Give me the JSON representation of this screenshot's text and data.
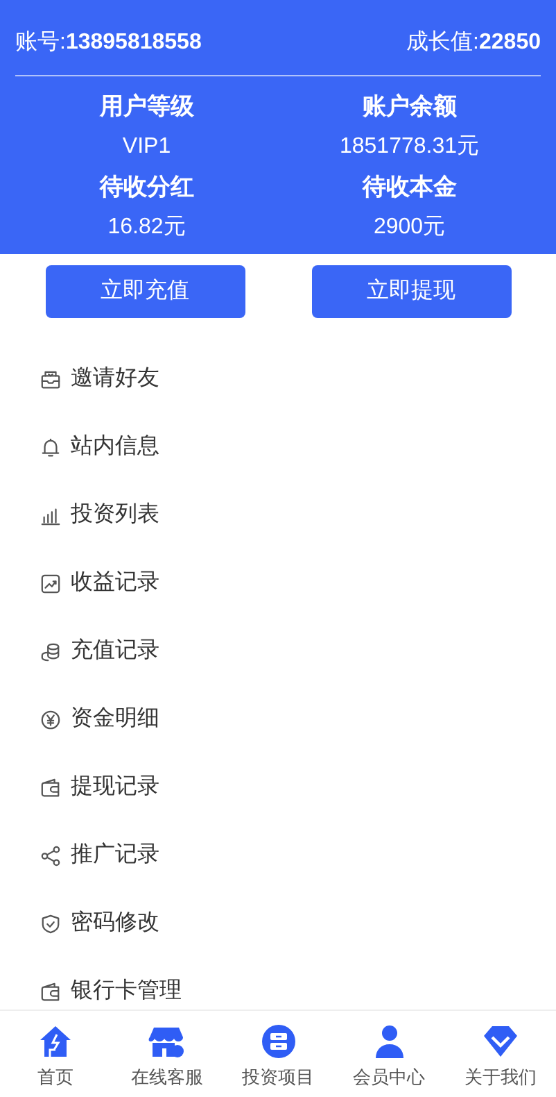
{
  "account": {
    "label": "账号:",
    "value": "13895818558"
  },
  "growth": {
    "label": "成长值:",
    "value": "22850"
  },
  "stats": [
    {
      "label": "用户等级",
      "value": "VIP1"
    },
    {
      "label": "账户余额",
      "value": "1851778.31元"
    },
    {
      "label": "待收分红",
      "value": "16.82元"
    },
    {
      "label": "待收本金",
      "value": "2900元"
    }
  ],
  "actions": [
    "立即充值",
    "立即提现"
  ],
  "menu": [
    {
      "label": "邀请好友"
    },
    {
      "label": "站内信息"
    },
    {
      "label": "投资列表"
    },
    {
      "label": "收益记录"
    },
    {
      "label": "充值记录"
    },
    {
      "label": "资金明细"
    },
    {
      "label": "提现记录"
    },
    {
      "label": "推广记录"
    },
    {
      "label": "密码修改"
    },
    {
      "label": "银行卡管理"
    }
  ],
  "tabbar": [
    {
      "label": "首页"
    },
    {
      "label": "在线客服"
    },
    {
      "label": "投资项目"
    },
    {
      "label": "会员中心"
    },
    {
      "label": "关于我们"
    }
  ]
}
